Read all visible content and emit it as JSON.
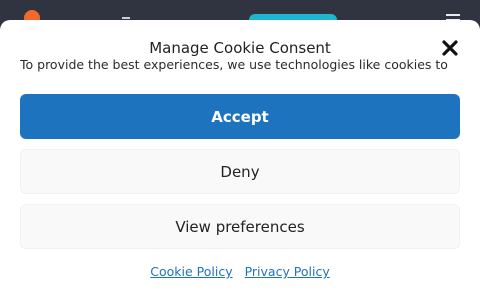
{
  "colors": {
    "accent": "#1e73be",
    "background_header": "#2f3440",
    "background_cta": "#1fb6d0",
    "logo_accent": "#f06a2b",
    "secondary_button_bg": "#f9f9f9"
  },
  "consent": {
    "title": "Manage Cookie Consent",
    "message": "To provide the best experiences, we use technologies like cookies to",
    "close_icon": "close-icon",
    "accept_label": "Accept",
    "deny_label": "Deny",
    "preferences_label": "View preferences",
    "links": [
      {
        "label": "Cookie Policy"
      },
      {
        "label": "Privacy Policy"
      }
    ]
  }
}
